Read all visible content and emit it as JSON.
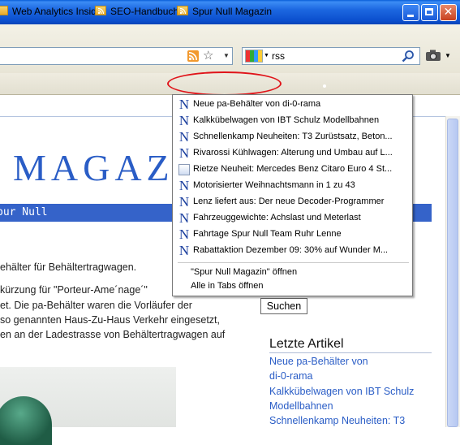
{
  "window": {
    "minimize_icon": "minimize-icon",
    "maximize_icon": "maximize-icon",
    "close_icon": "close-icon"
  },
  "toolbar": {
    "search_value": "rss",
    "icons": [
      "rss-feed-icon",
      "bookmark-star-icon",
      "search-engine-icon",
      "magnifier-icon",
      "camera-icon"
    ]
  },
  "bookmarks": [
    {
      "label": "Web Analytics Inside"
    },
    {
      "label": "SEO-Handbuch"
    },
    {
      "label": "Spur Null Magazin"
    }
  ],
  "feed_menu": {
    "items": [
      {
        "label": "Neue pa-Behälter von di-0-rama"
      },
      {
        "label": "Kalkkübelwagen von IBT Schulz Modellbahnen"
      },
      {
        "label": "Schnellenkamp Neuheiten: T3 Zurüstsatz, Beton..."
      },
      {
        "label": "Rivarossi Kühlwagen: Alterung und Umbau auf L..."
      },
      {
        "label": "Rietze Neuheit: Mercedes Benz Citaro Euro 4 St..."
      },
      {
        "label": "Motorisierter Weihnachtsmann in 1 zu 43"
      },
      {
        "label": "Lenz liefert aus: Der neue Decoder-Programmer"
      },
      {
        "label": "Fahrzeuggewichte: Achslast und Meterlast"
      },
      {
        "label": "Fahrtage Spur Null Team Ruhr Lenne"
      },
      {
        "label": "Rabattaktion Dezember 09: 30% auf Wunder M..."
      }
    ],
    "open_label": "\"Spur Null Magazin\" öffnen",
    "open_tabs_label": "Alle in Tabs öffnen"
  },
  "page": {
    "site_title": "MAGAZ",
    "nav_text": "pur Null",
    "body_lines": [
      "ehälter für Behältertragwagen.",
      "kürzung für \"Porteur-Ame´nage´\"",
      "et. Die pa-Behälter waren die Vorläufer der",
      "so genannten Haus-Zu-Haus Verkehr eingesetzt,",
      "en an der Ladestrasse von Behältertragwagen auf"
    ],
    "search_button": "Suchen",
    "sidebar_heading": "Letzte Artikel",
    "sidebar_links": [
      "Neue pa-Behälter von",
      "di-0-rama",
      "Kalkkübelwagen von IBT Schulz",
      "Modellbahnen",
      "Schnellenkamp Neuheiten: T3"
    ]
  },
  "colors": {
    "titlebar": "#1c67e0",
    "site_blue": "#2a5dc6",
    "nav_strip": "#3563c9",
    "highlight_ellipse": "#e0141a"
  }
}
